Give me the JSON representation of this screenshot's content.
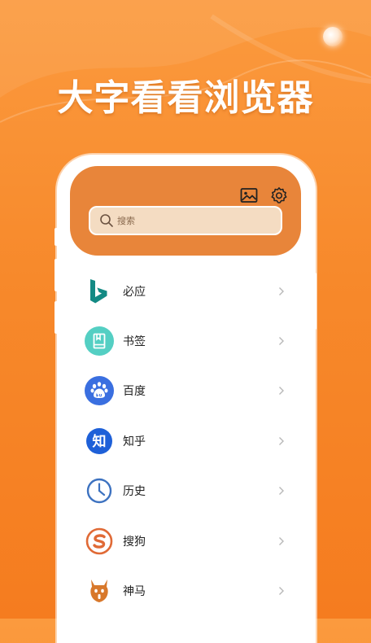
{
  "hero": {
    "title": "大字看看浏览器"
  },
  "header": {
    "icons": [
      "image-icon",
      "gear-icon"
    ],
    "search": {
      "placeholder": "搜索"
    }
  },
  "list": {
    "items": [
      {
        "label": "必应",
        "icon": "bing-logo-icon"
      },
      {
        "label": "书签",
        "icon": "bookmark-icon"
      },
      {
        "label": "百度",
        "icon": "baidu-paw-icon"
      },
      {
        "label": "知乎",
        "icon": "zhihu-icon",
        "glyph": "知"
      },
      {
        "label": "历史",
        "icon": "clock-icon"
      },
      {
        "label": "搜狗",
        "icon": "sogou-icon"
      },
      {
        "label": "神马",
        "icon": "shenma-icon"
      }
    ]
  },
  "colors": {
    "accent": "#e8853a",
    "background": "#f7892b",
    "bing": "#138a84",
    "bookmark_bg": "#54cfc3",
    "baidu": "#3a6fe0",
    "zhihu": "#1e60d8",
    "history": "#3d72c0",
    "sogou": "#e06a36",
    "shenma": "#d8782b"
  }
}
